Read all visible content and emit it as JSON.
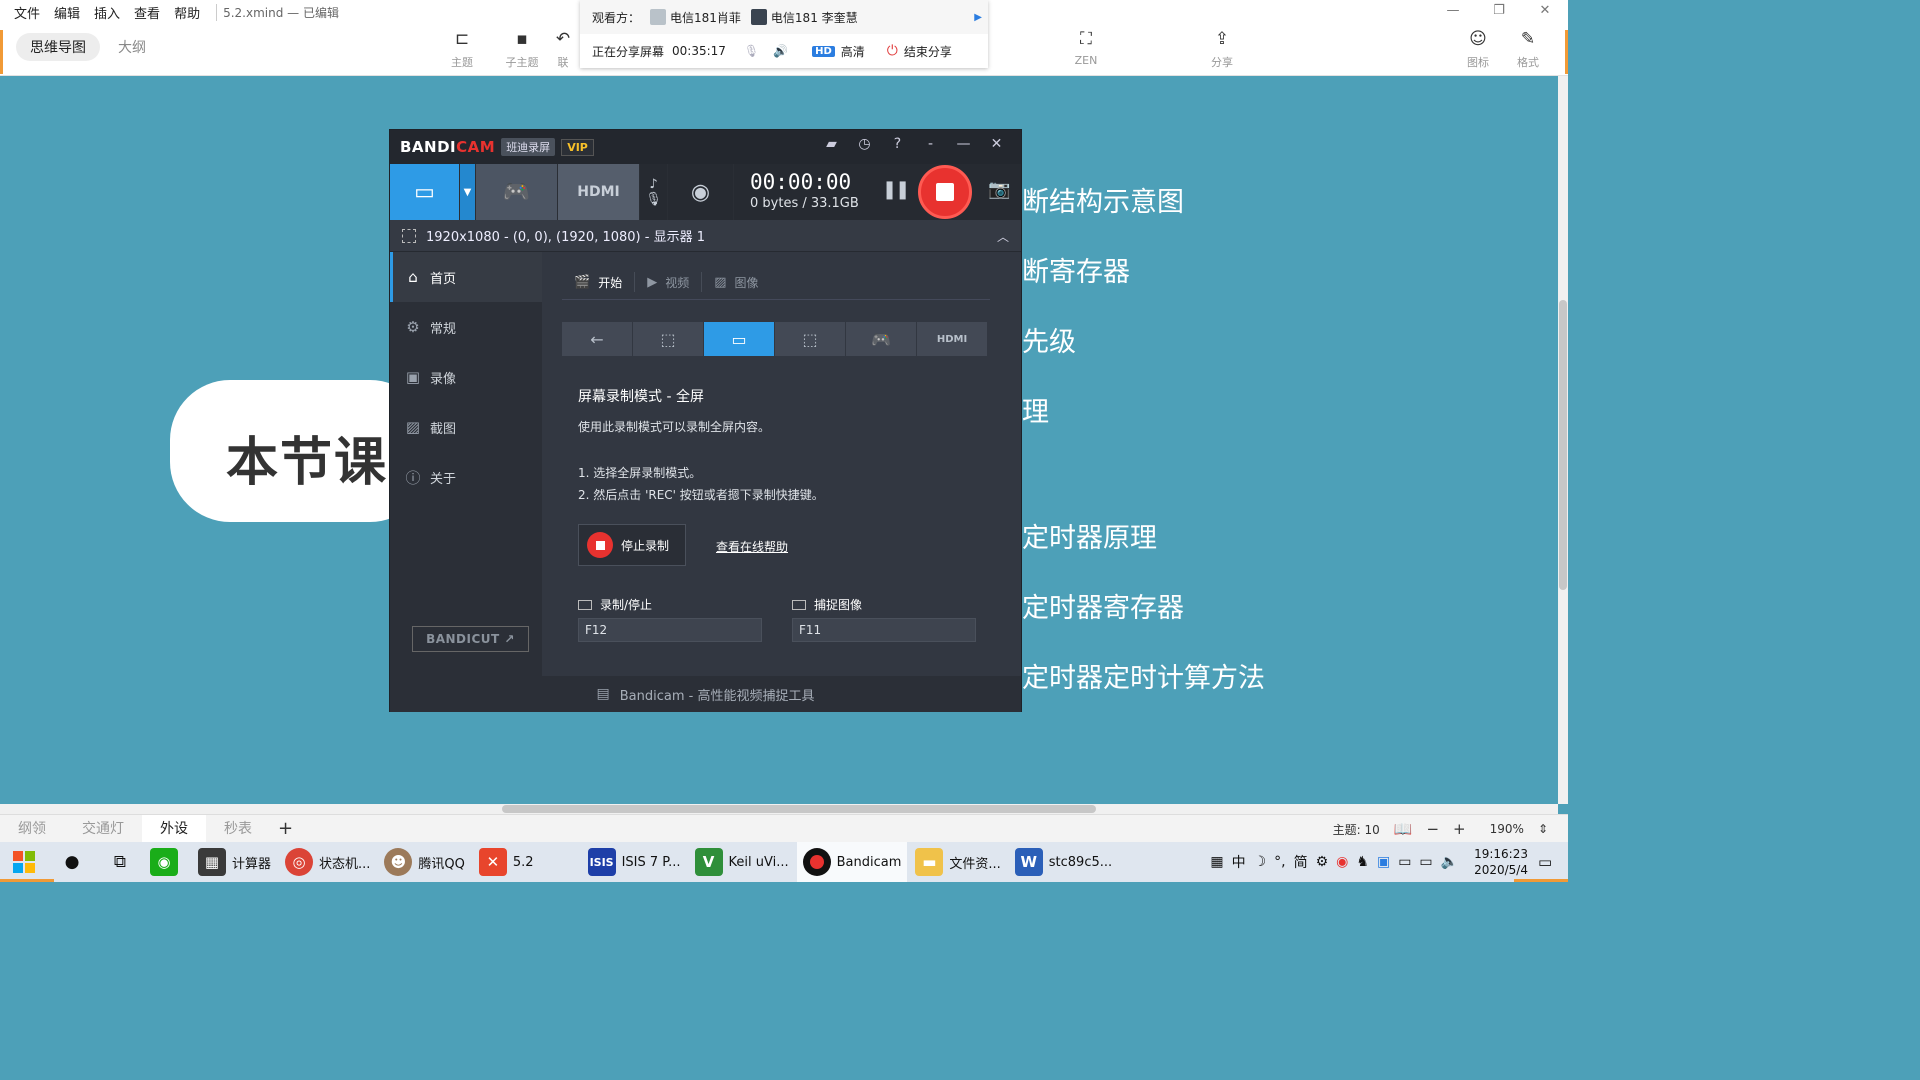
{
  "menubar": {
    "items": [
      "文件",
      "编辑",
      "插入",
      "查看",
      "帮助"
    ],
    "doc_title": "5.2.xmind — 已编辑"
  },
  "toolbar": {
    "view_tabs": [
      "思维导图",
      "大纲"
    ],
    "topic_label": "主题",
    "subtopic_label": "子主题",
    "link_label": "联",
    "zen_label": "ZEN",
    "share_label": "分享",
    "icon_label": "图标",
    "format_label": "格式"
  },
  "share_bar": {
    "viewers_label": "观看方：",
    "viewer1": "电信181肖菲",
    "viewer2": "电信181 李奎慧",
    "sharing_label": "正在分享屏幕",
    "duration": "00:35:17",
    "hd_badge": "HD",
    "hd_label": "高清",
    "end_label": "结束分享"
  },
  "mindmap": {
    "central_topic": "本节课",
    "topics": [
      "断结构示意图",
      "断寄存器",
      "先级",
      "理",
      "定时器原理",
      "定时器寄存器",
      "定时器定时计算方法"
    ]
  },
  "bandicam": {
    "logo_main": "BANDI",
    "logo_accent": "CAM",
    "logo_cn": "班迪录屏",
    "vip": "VIP",
    "rec_time": "00:00:00",
    "rec_size": "0 bytes / 33.1GB",
    "region": "1920x1080 - (0, 0), (1920, 1080) - 显示器 1",
    "hdmi_label": "HDMI",
    "sidebar": [
      "首页",
      "常规",
      "录像",
      "截图",
      "关于"
    ],
    "bandicut": "BANDICUT ↗",
    "sub_tabs": [
      "开始",
      "视频",
      "图像"
    ],
    "mode_title": "屏幕录制模式 - 全屏",
    "mode_desc": "使用此录制模式可以录制全屏内容。",
    "step1": "1. 选择全屏录制模式。",
    "step2": "2. 然后点击 'REC' 按钮或者摁下录制快捷键。",
    "stop_label": "停止录制",
    "help_link": "查看在线帮助",
    "hotkey_rec_label": "录制/停止",
    "hotkey_rec_value": "F12",
    "hotkey_cap_label": "捕捉图像",
    "hotkey_cap_value": "F11",
    "footer": "Bandicam - 高性能视频捕捉工具"
  },
  "sheetbar": {
    "tabs": [
      "纲领",
      "交通灯",
      "外设",
      "秒表"
    ],
    "active": "外设",
    "topic_count": "主题: 10",
    "zoom": "190%"
  },
  "taskbar": {
    "apps": [
      {
        "label": "",
        "color": "#1aad19",
        "icon": "wechat-icon"
      },
      {
        "label": "计算器",
        "color": "#3a3a3a",
        "icon": "calculator-icon"
      },
      {
        "label": "状态机...",
        "color": "#e0e0e0",
        "icon": "chrome-icon"
      },
      {
        "label": "腾讯QQ",
        "color": "#9c7a5a",
        "icon": "qq-avatar-icon"
      },
      {
        "label": "5.2",
        "color": "#e8452c",
        "icon": "xmind-icon"
      },
      {
        "label": "ISIS 7 P...",
        "color": "#1e3fa8",
        "icon": "isis-icon"
      },
      {
        "label": "Keil uVi...",
        "color": "#2f8f3a",
        "icon": "keil-icon"
      },
      {
        "label": "Bandicam",
        "color": "#e8322f",
        "icon": "bandicam-icon"
      },
      {
        "label": "文件资...",
        "color": "#f0c24a",
        "icon": "explorer-icon"
      },
      {
        "label": "stc89c5...",
        "color": "#2b5fb8",
        "icon": "word-icon"
      }
    ],
    "ime": "中",
    "ime2": "简",
    "time": "19:16:23",
    "date": "2020/5/4"
  },
  "colors": {
    "canvas_bg": "#4da0b8",
    "accent_blue": "#2e9be6",
    "rec_red": "#e8322f",
    "orange": "#f19a36"
  }
}
